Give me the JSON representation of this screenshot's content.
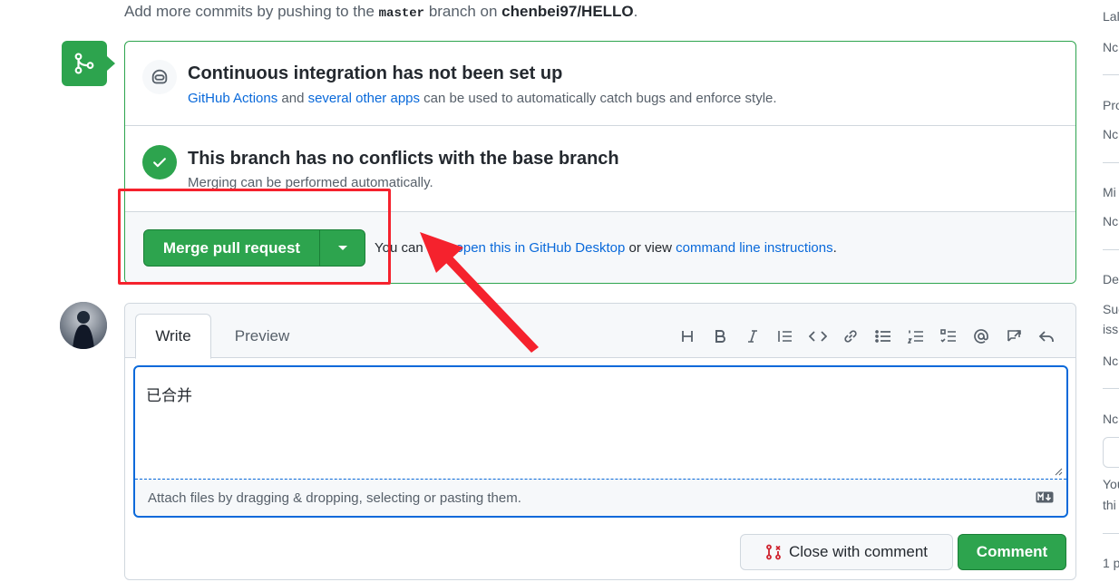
{
  "top_line": {
    "prefix": "Add more commits by pushing to the",
    "branch": "master",
    "middle": "branch on",
    "repo": "chenbei97/HELLO",
    "suffix": "."
  },
  "ci": {
    "title": "Continuous integration has not been set up",
    "link1": "GitHub Actions",
    "and": "and",
    "link2": "several other apps",
    "rest": "can be used to automatically catch bugs and enforce style."
  },
  "conflicts": {
    "title": "This branch has no conflicts with the base branch",
    "desc": "Merging can be performed automatically."
  },
  "merge": {
    "button_label": "Merge pull request",
    "also_prefix": "You can also",
    "link_desktop": "open this in GitHub Desktop",
    "or_view": "or view",
    "link_cli": "command line instructions",
    "suffix": "."
  },
  "comment": {
    "tab_write": "Write",
    "tab_preview": "Preview",
    "text": "已合并",
    "attach_hint": "Attach files by dragging & dropping, selecting or pasting them.",
    "close_label": "Close with comment",
    "submit_label": "Comment",
    "toolbar_icons": [
      "heading-icon",
      "bold-icon",
      "italic-icon",
      "quote-icon",
      "code-icon",
      "link-icon",
      "unordered-list-icon",
      "ordered-list-icon",
      "task-list-icon",
      "mention-icon",
      "reference-icon",
      "reply-icon"
    ]
  },
  "sidebar": {
    "labels": [
      "Lal",
      "Nc",
      "Pro",
      "Nc",
      "Mi",
      "Nc",
      "De",
      "Suc",
      "issi",
      "Nc",
      "Nc",
      "You",
      "thi",
      "1 p"
    ]
  },
  "colors": {
    "green": "#2da44e",
    "link": "#0969da",
    "annotation": "#f5222d"
  }
}
